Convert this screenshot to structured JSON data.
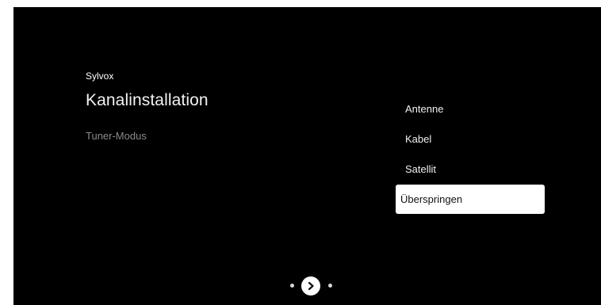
{
  "brand": "Sylvox",
  "page_title": "Kanalinstallation",
  "subtitle": "Tuner-Modus",
  "options": [
    {
      "label": "Antenne",
      "selected": false
    },
    {
      "label": "Kabel",
      "selected": false
    },
    {
      "label": "Satellit",
      "selected": false
    },
    {
      "label": "Überspringen",
      "selected": true
    }
  ],
  "pager": {
    "next_icon": "chevron-right-icon"
  },
  "colors": {
    "background": "#000000",
    "selected_bg": "#ffffff",
    "subtitle": "#8a8a8a"
  }
}
